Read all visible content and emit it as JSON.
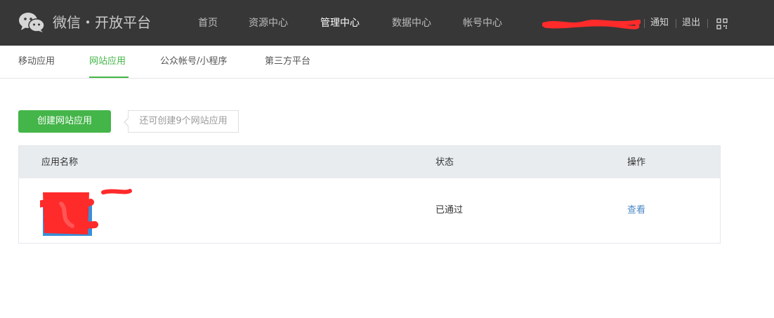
{
  "header": {
    "brand": "微信・开放平台",
    "nav": [
      {
        "label": "首页"
      },
      {
        "label": "资源中心"
      },
      {
        "label": "管理中心"
      },
      {
        "label": "数据中心"
      },
      {
        "label": "帐号中心"
      }
    ],
    "active_nav": "管理中心",
    "notify_label": "通知",
    "logout_label": "退出"
  },
  "subnav": {
    "tabs": [
      {
        "label": "移动应用"
      },
      {
        "label": "网站应用"
      },
      {
        "label": "公众帐号/小程序"
      },
      {
        "label": "第三方平台"
      }
    ],
    "active_tab": "网站应用"
  },
  "actions": {
    "create_label": "创建网站应用",
    "tip": "还可创建9个网站应用"
  },
  "table": {
    "columns": [
      "应用名称",
      "状态",
      "操作"
    ],
    "rows": [
      {
        "status": "已通过",
        "action": "查看"
      }
    ]
  },
  "colors": {
    "header_bg": "#373737",
    "accent_green": "#44b549",
    "link_blue": "#4b87c5",
    "table_header_bg": "#e8ecef",
    "redaction": "#ff2a2a"
  },
  "icons": {
    "logo": "wechat-logo-icon",
    "qr": "qr-code-icon"
  }
}
